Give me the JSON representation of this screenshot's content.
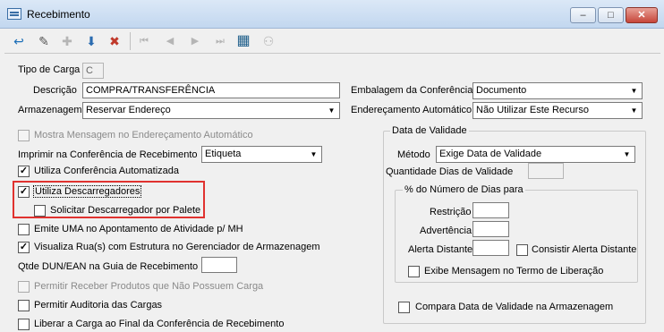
{
  "window": {
    "title": "Recebimento",
    "min": "–",
    "max": "□",
    "close": "✕"
  },
  "toolbar": {
    "buttons": [
      {
        "icon": "exit-icon",
        "glyph": "↩"
      },
      {
        "icon": "edit-icon",
        "glyph": "✎"
      },
      {
        "icon": "new-icon",
        "glyph": "✚"
      },
      {
        "icon": "save-icon",
        "glyph": "⬇"
      },
      {
        "icon": "delete-icon",
        "glyph": "✖"
      },
      {
        "icon": "first-icon",
        "glyph": "⏮"
      },
      {
        "icon": "prev-icon",
        "glyph": "◀"
      },
      {
        "icon": "next-icon",
        "glyph": "▶"
      },
      {
        "icon": "last-icon",
        "glyph": "⏭"
      },
      {
        "icon": "grid-icon",
        "glyph": "▦"
      },
      {
        "icon": "binoculars-icon",
        "glyph": "⚇"
      }
    ]
  },
  "form": {
    "tipo_carga": {
      "label": "Tipo de Carga",
      "value": "C"
    },
    "descricao": {
      "label": "Descrição",
      "value": "COMPRA/TRANSFERÊNCIA"
    },
    "armazenagem": {
      "label": "Armazenagem",
      "value": "Reservar Endereço"
    },
    "embalagem": {
      "label": "Embalagem da Conferência",
      "value": "Documento"
    },
    "enderecamento": {
      "label": "Endereçamento Automático",
      "value": "Não Utilizar Este Recurso"
    },
    "mostra_msg": {
      "label": "Mostra Mensagem no Endereçamento Automático",
      "checked": false
    },
    "imprimir": {
      "label": "Imprimir na Conferência de Recebimento",
      "value": "Etiqueta"
    },
    "utiliza_conf_auto": {
      "label": "Utiliza Conferência Automatizada",
      "checked": true
    },
    "utiliza_desc": {
      "label": "Utiliza Descarregadores",
      "checked": true
    },
    "solicitar_desc": {
      "label": "Solicitar Descarregador por Palete",
      "checked": false
    },
    "emite_uma": {
      "label": "Emite UMA no Apontamento de Atividade p/ MH",
      "checked": false
    },
    "visualiza_rua": {
      "label": "Visualiza Rua(s) com Estrutura no Gerenciador de Armazenagem",
      "checked": true
    },
    "qtde_dun": {
      "label": "Qtde DUN/EAN na Guia de Recebimento",
      "value": ""
    },
    "permitir_receber": {
      "label": "Permitir Receber Produtos que Não Possuem Carga",
      "checked": false
    },
    "permitir_auditoria": {
      "label": "Permitir Auditoria das Cargas",
      "checked": false
    },
    "liberar_carga": {
      "label": "Liberar a Carga ao Final da Conferência de Recebimento",
      "checked": false
    }
  },
  "validade": {
    "group_title": "Data de Validade",
    "metodo": {
      "label": "Método",
      "value": "Exige Data de Validade"
    },
    "quantidade_dias": {
      "label": "Quantidade Dias de Validade",
      "value": ""
    },
    "percent_group_title": "% do Número de Dias para",
    "restricao": {
      "label": "Restrição",
      "value": ""
    },
    "advertencia": {
      "label": "Advertência",
      "value": ""
    },
    "alerta_distante": {
      "label": "Alerta Distante",
      "value": ""
    },
    "consistir_alerta": {
      "label": "Consistir Alerta Distante",
      "checked": false
    },
    "exibe_msg": {
      "label": "Exibe Mensagem no Termo de Liberação",
      "checked": false
    },
    "compara_data": {
      "label": "Compara Data de Validade na Armazenagem",
      "checked": false
    }
  },
  "colors": {
    "highlight": "#e0322f",
    "titlebar": "#c2d7ef"
  }
}
